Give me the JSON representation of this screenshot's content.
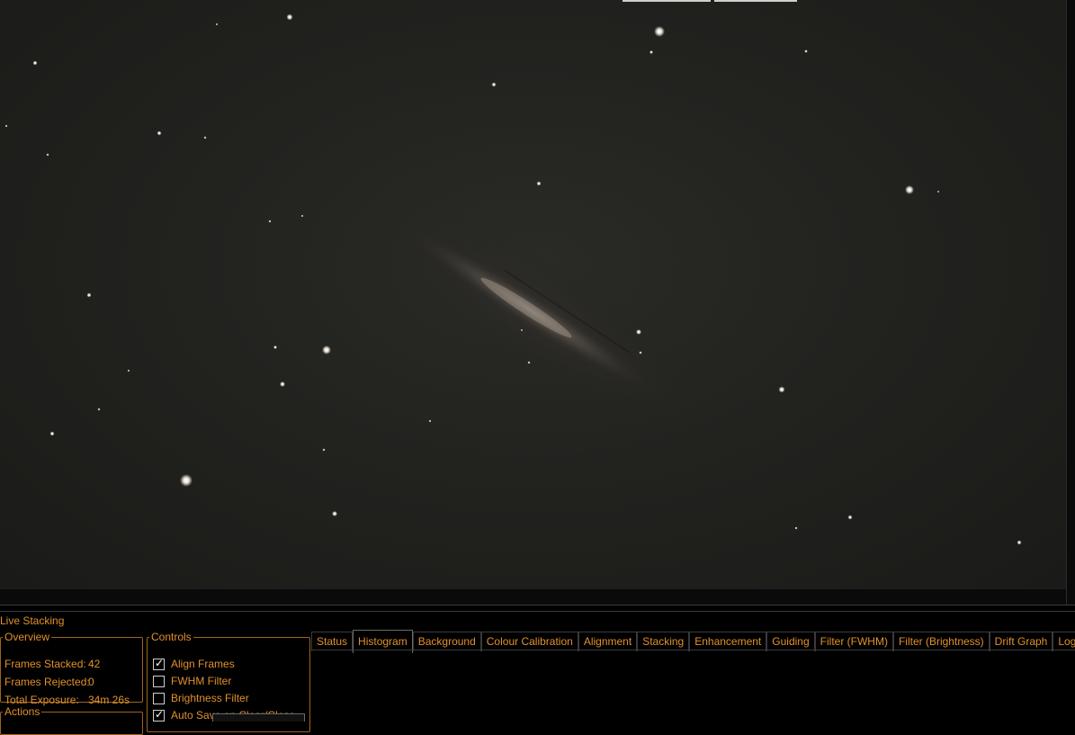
{
  "panel": {
    "title": "Live Stacking",
    "overview": {
      "legend": "Overview",
      "frames_stacked_label": "Frames Stacked:",
      "frames_stacked_value": "42",
      "frames_rejected_label": "Frames Rejected:",
      "frames_rejected_value": "0",
      "total_exposure_label": "Total Exposure:",
      "total_exposure_value": "34m 26s"
    },
    "actions": {
      "legend": "Actions"
    },
    "controls": {
      "legend": "Controls",
      "items": [
        {
          "label": "Align Frames",
          "checked": true
        },
        {
          "label": "FWHM Filter",
          "checked": false
        },
        {
          "label": "Brightness Filter",
          "checked": false
        },
        {
          "label": "Auto Save on Clear/Close",
          "checked": true
        }
      ]
    },
    "tabs": [
      {
        "label": "Status"
      },
      {
        "label": "Histogram",
        "active": true
      },
      {
        "label": "Background"
      },
      {
        "label": "Colour Calibration"
      },
      {
        "label": "Alignment"
      },
      {
        "label": "Stacking"
      },
      {
        "label": "Enhancement"
      },
      {
        "label": "Guiding"
      },
      {
        "label": "Filter (FWHM)"
      },
      {
        "label": "Filter (Brightness)"
      },
      {
        "label": "Drift Graph"
      },
      {
        "label": "Log"
      }
    ]
  },
  "colors": {
    "accent": "#e0902c",
    "background": "#000000",
    "sky": "#22221f"
  }
}
